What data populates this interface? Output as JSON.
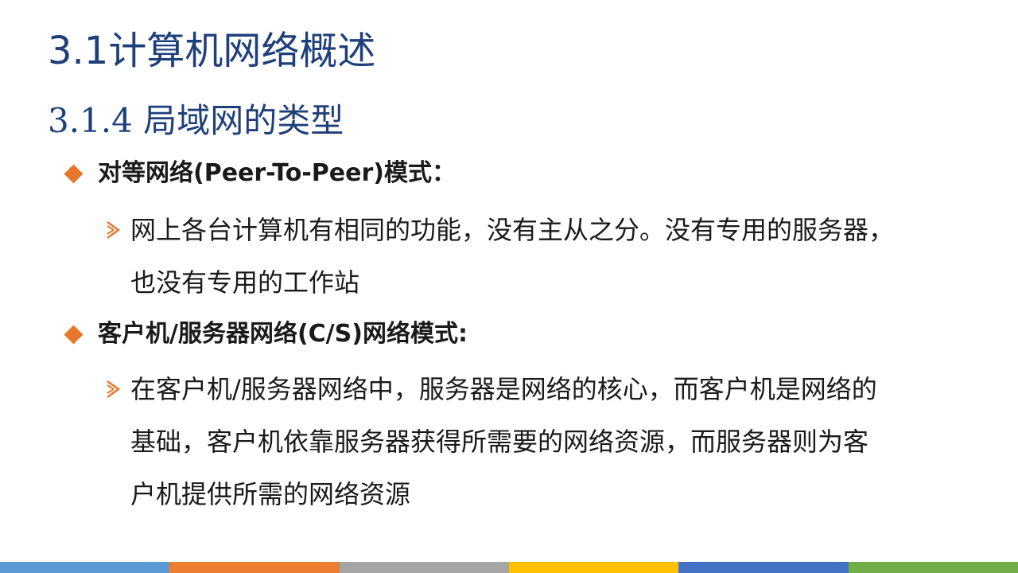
{
  "title": "3.1计算机网络概述",
  "subtitle": "3.1.4 局域网的类型",
  "bullets": [
    {
      "label": "对等网络(Peer-To-Peer)模式：",
      "sub_lines": [
        "网上各台计算机有相同的功能，没有主从之分。没有专用的服务器，",
        "也没有专用的工作站"
      ]
    },
    {
      "label": "客户机/服务器网络(C/S)网络模式:",
      "sub_lines": [
        "在客户机/服务器网络中，服务器是网络的核心，而客户机是网络的",
        "基础，客户机依靠服务器获得所需要的网络资源，而服务器则为客",
        "户机提供所需的网络资源"
      ]
    }
  ],
  "colors": {
    "title": "#1f3f7a",
    "bullet_diamond": "#e8772e",
    "sub_arrow": "#e8772e",
    "footer": [
      "#5b9bd5",
      "#ed7d31",
      "#a5a5a5",
      "#ffc000",
      "#4472c4",
      "#70ad47"
    ]
  },
  "icons": {
    "bullet": "orange-diamond-icon",
    "sub_bullet": "arrow-right-icon"
  }
}
